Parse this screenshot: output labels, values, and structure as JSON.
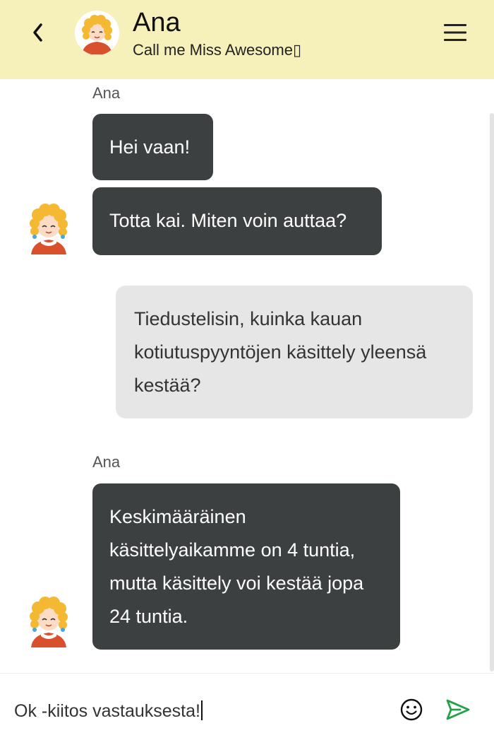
{
  "header": {
    "name": "Ana",
    "status": "Call me Miss Awesome▯"
  },
  "messages": [
    {
      "sender": "Ana",
      "text": "Hei vaan!"
    },
    {
      "text": "Totta kai. Miten voin auttaa?"
    },
    {
      "text": "Tiedustelisin, kuinka kauan kotiutuspyyntöjen käsittely yleensä kestää?"
    },
    {
      "sender": "Ana",
      "text": "Keskimääräinen käsittelyaikamme on 4 tuntia, mutta käsittely voi kestää jopa 24 tuntia."
    }
  ],
  "composer": {
    "value": "Ok -kiitos vastauksesta!"
  },
  "icons": {
    "back": "chevron-left-icon",
    "menu": "hamburger-menu-icon",
    "emoji": "smiley-icon",
    "send": "send-icon"
  },
  "colors": {
    "header_bg": "#f6f1bb",
    "bot_bubble": "#3d4040",
    "user_bubble": "#e6e6e6",
    "send_icon": "#22a04a"
  }
}
